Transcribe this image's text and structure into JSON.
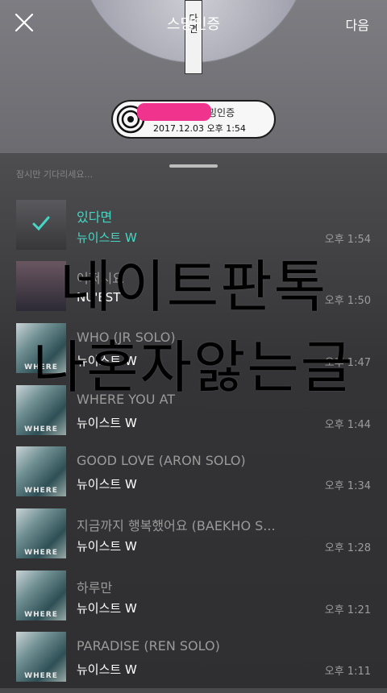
{
  "header": {
    "title": "스밍인증",
    "next_label": "다음",
    "art_strip_chars": [
      "다",
      "면"
    ]
  },
  "badge": {
    "brand_suffix": "밍인증",
    "datetime": "2017.12.03 오후 1:54"
  },
  "sheet": {
    "hint": "잠시만 기다리세요..."
  },
  "songs": [
    {
      "title": "있다면",
      "artist": "뉴이스트 W",
      "time": "오후 1:54",
      "selected": true,
      "thumb": "band"
    },
    {
      "title": "어쩌시요",
      "artist": "NU'EST",
      "time": "오후 1:50",
      "selected": false,
      "thumb": "studio"
    },
    {
      "title": "WHO (JR SOLO)",
      "artist": "뉴이스트 W",
      "time": "오후 1:47",
      "selected": false,
      "thumb": "ocean"
    },
    {
      "title": "WHERE YOU AT",
      "artist": "뉴이스트 W",
      "time": "오후 1:44",
      "selected": false,
      "thumb": "ocean"
    },
    {
      "title": "GOOD LOVE (ARON SOLO)",
      "artist": "뉴이스트 W",
      "time": "오후 1:34",
      "selected": false,
      "thumb": "ocean"
    },
    {
      "title": "지금까지 행복했어요 (BAEKHO S...",
      "artist": "뉴이스트 W",
      "time": "오후 1:28",
      "selected": false,
      "thumb": "ocean"
    },
    {
      "title": "하루만",
      "artist": "뉴이스트 W",
      "time": "오후 1:21",
      "selected": false,
      "thumb": "ocean"
    },
    {
      "title": "PARADISE (REN SOLO)",
      "artist": "뉴이스트 W",
      "time": "오후 1:11",
      "selected": false,
      "thumb": "ocean"
    }
  ],
  "album_label": "WHERE",
  "overlay": {
    "line1": "네이트판톡",
    "line2": "나혼자앓는글"
  },
  "colors": {
    "accent": "#45d7c4",
    "redaction": "#f0338c"
  }
}
